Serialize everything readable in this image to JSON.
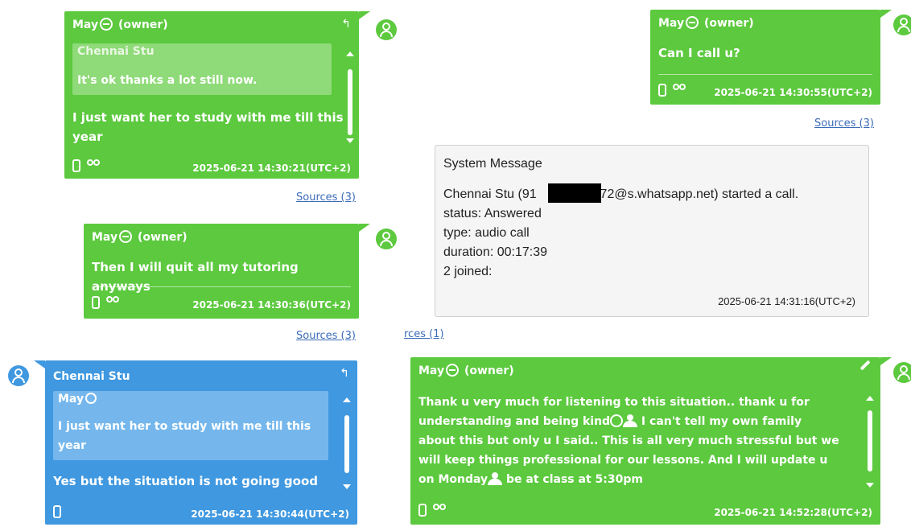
{
  "messages": [
    {
      "sender": "May",
      "role": "(owner)",
      "quote": {
        "name": "Chennai Stu",
        "text": "It's ok thanks a lot still now."
      },
      "body_lines": [
        "I just want her to study with me till this",
        "year"
      ],
      "timestamp": "2025-06-21 14:30:21(UTC+2)",
      "sources": "Sources (3)"
    },
    {
      "sender": "May",
      "role": "(owner)",
      "body_lines": [
        "Then I will quit all my tutoring anyways"
      ],
      "timestamp": "2025-06-21 14:30:36(UTC+2)",
      "sources": "Sources (3)"
    },
    {
      "sender": "Chennai Stu",
      "quote": {
        "name": "May",
        "text_lines": [
          "I just want her to study with me till this",
          "year"
        ]
      },
      "body_lines": [
        "Yes but the situation is not going good"
      ],
      "timestamp": "2025-06-21 14:30:44(UTC+2)"
    },
    {
      "sender": "May",
      "role": "(owner)",
      "body_lines": [
        "Can I call u?"
      ],
      "timestamp": "2025-06-21 14:30:55(UTC+2)",
      "sources": "Sources (3)"
    },
    {
      "sender": "May",
      "role": "(owner)",
      "body_lines": [
        "Thank u very much for listening to this situation.. thank u for",
        "understanding and being kind",
        " I can't tell my own family",
        "about this but only u I said.. This is all very much stressful but we",
        "will keep things professional for our lessons. And I will update u",
        "on Monday",
        " be at class at 5:30pm"
      ],
      "timestamp": "2025-06-21 14:52:28(UTC+2)"
    }
  ],
  "system_message": {
    "title": "System Message",
    "line1_prefix": "Chennai Stu (91",
    "line1_suffix": "372@s.whatsapp.net) started a call.",
    "status": "status: Answered",
    "type": "type: audio call",
    "duration": "duration: 00:17:39",
    "joined": "2 joined:",
    "timestamp": "2025-06-21 14:31:16(UTC+2)",
    "sources": "rces (1)"
  },
  "colors": {
    "green": "#5cc93e",
    "blue": "#3f98e0",
    "link": "#3b6bb8"
  }
}
